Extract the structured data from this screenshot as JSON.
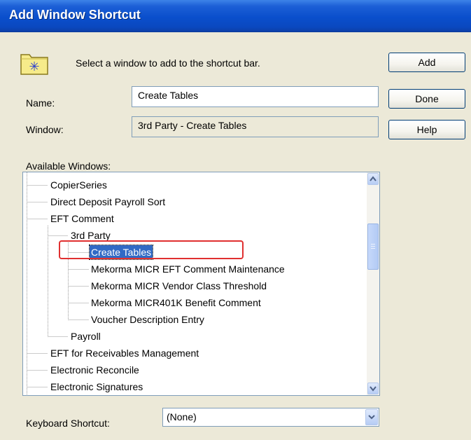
{
  "window": {
    "title": "Add Window Shortcut"
  },
  "header": {
    "instruction": "Select a window to add to the shortcut bar."
  },
  "buttons": {
    "add": "Add",
    "done": "Done",
    "help": "Help"
  },
  "form": {
    "name_label": "Name:",
    "name_value": "Create Tables",
    "window_label": "Window:",
    "window_value": "3rd Party - Create Tables"
  },
  "tree": {
    "label": "Available Windows:",
    "items": [
      "CopierSeries",
      "Direct Deposit Payroll Sort",
      "EFT Comment",
      "3rd Party",
      "Create Tables",
      "Mekorma MICR EFT Comment Maintenance",
      "Mekorma MICR Vendor Class Threshold",
      "Mekorma MICR401K Benefit Comment",
      "Voucher Description Entry",
      "Payroll",
      "EFT for Receivables Management",
      "Electronic Reconcile",
      "Electronic Signatures"
    ],
    "selected": "Create Tables"
  },
  "keyboard_shortcut": {
    "label": "Keyboard Shortcut:",
    "value": "(None)"
  },
  "colors": {
    "title_bar": "#0a4fcc",
    "selection": "#316ac5",
    "highlight_box": "#e03030",
    "dialog_bg": "#ece9d8"
  },
  "icons": [
    "folder-star-icon",
    "scroll-up-icon",
    "scroll-down-icon",
    "dropdown-arrow-icon"
  ]
}
